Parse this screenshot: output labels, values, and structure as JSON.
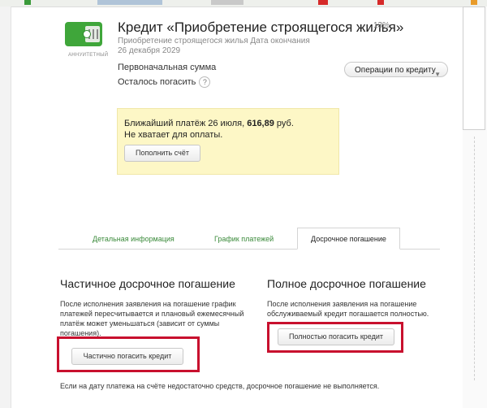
{
  "loan": {
    "badge": "АННУИТЕТНЫЙ",
    "title": "Кредит «Приобретение строящегося жилья»",
    "rate": "13%",
    "subtitle": "Приобретение строящегося жилья Дата окончания 26 декабря 2029",
    "initial_amount_label": "Первоначальная сумма",
    "remaining_label": "Осталось погасить",
    "help_icon": "?",
    "operations_button": "Операции по кредиту"
  },
  "payment": {
    "line1_prefix": "Ближайший платёж 26 июля, ",
    "amount": "616,89",
    "line1_suffix": " руб.",
    "line2": "Не хватает для оплаты.",
    "topup_button": "Пополнить счёт"
  },
  "tabs": {
    "details": "Детальная информация",
    "schedule": "График платежей",
    "early": "Досрочное погашение"
  },
  "partial": {
    "title": "Частичное досрочное погашение",
    "text": "После исполнения заявления на погашение график платежей пересчитывается и плановый ежемесячный платёж может уменьшаться (зависит от суммы погашения).",
    "button": "Частично погасить кредит"
  },
  "full": {
    "title": "Полное досрочное погашение",
    "text": "После исполнения заявления на погашение обслуживаемый кредит погашается полностью.",
    "button": "Полностью погасить кредит"
  },
  "note": "Если на дату платежа на счёте недостаточно средств, досрочное погашение не выполняется.",
  "colors": {
    "accent_green": "#3fa63a",
    "highlight_red": "#c8102e",
    "payment_box": "#fdf7c6"
  },
  "icons": {
    "card": "wallet-card-icon",
    "dropdown": "chevron-down-icon"
  }
}
